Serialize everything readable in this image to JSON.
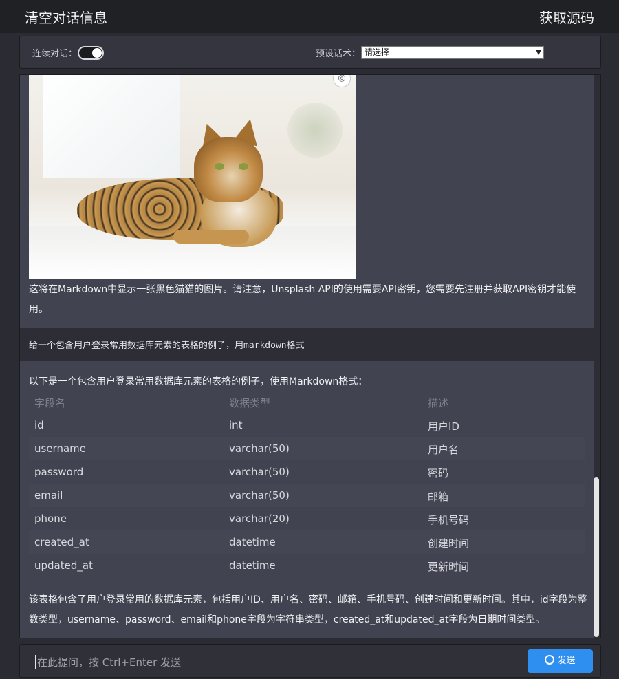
{
  "header": {
    "clear_label": "清空对话信息",
    "source_label": "获取源码"
  },
  "controls": {
    "continuous_label": "连续对话：",
    "continuous_on": true,
    "preset_label": "预设话术：",
    "preset_value": "请选择"
  },
  "messages": {
    "bot1_text": "这将在Markdown中显示一张黑色猫猫的图片。请注意，Unsplash API的使用需要API密钥，您需要先注册并获取API密钥才能使用。",
    "user_text": "给一个包含用户登录常用数据库元素的表格的例子，用markdown格式",
    "bot2_intro": "以下是一个包含用户登录常用数据库元素的表格的例子，使用Markdown格式：",
    "table": {
      "headers": [
        "字段名",
        "数据类型",
        "描述"
      ],
      "rows": [
        [
          "id",
          "int",
          "用户ID"
        ],
        [
          "username",
          "varchar(50)",
          "用户名"
        ],
        [
          "password",
          "varchar(50)",
          "密码"
        ],
        [
          "email",
          "varchar(50)",
          "邮箱"
        ],
        [
          "phone",
          "varchar(20)",
          "手机号码"
        ],
        [
          "created_at",
          "datetime",
          "创建时间"
        ],
        [
          "updated_at",
          "datetime",
          "更新时间"
        ]
      ]
    },
    "bot2_outro": "该表格包含了用户登录常用的数据库元素，包括用户ID、用户名、密码、邮箱、手机号码、创建时间和更新时间。其中，id字段为整数类型，username、password、email和phone字段为字符串类型，created_at和updated_at字段为日期时间类型。"
  },
  "input": {
    "placeholder": "在此提问，按 Ctrl+Enter 发送",
    "send_label": "发送"
  },
  "colors": {
    "accent": "#2f8ff0",
    "bot_bg": "#414350",
    "page_bg": "#2b2c33"
  },
  "icons": {
    "image_action": "camera-scan-icon",
    "send": "send-icon"
  }
}
